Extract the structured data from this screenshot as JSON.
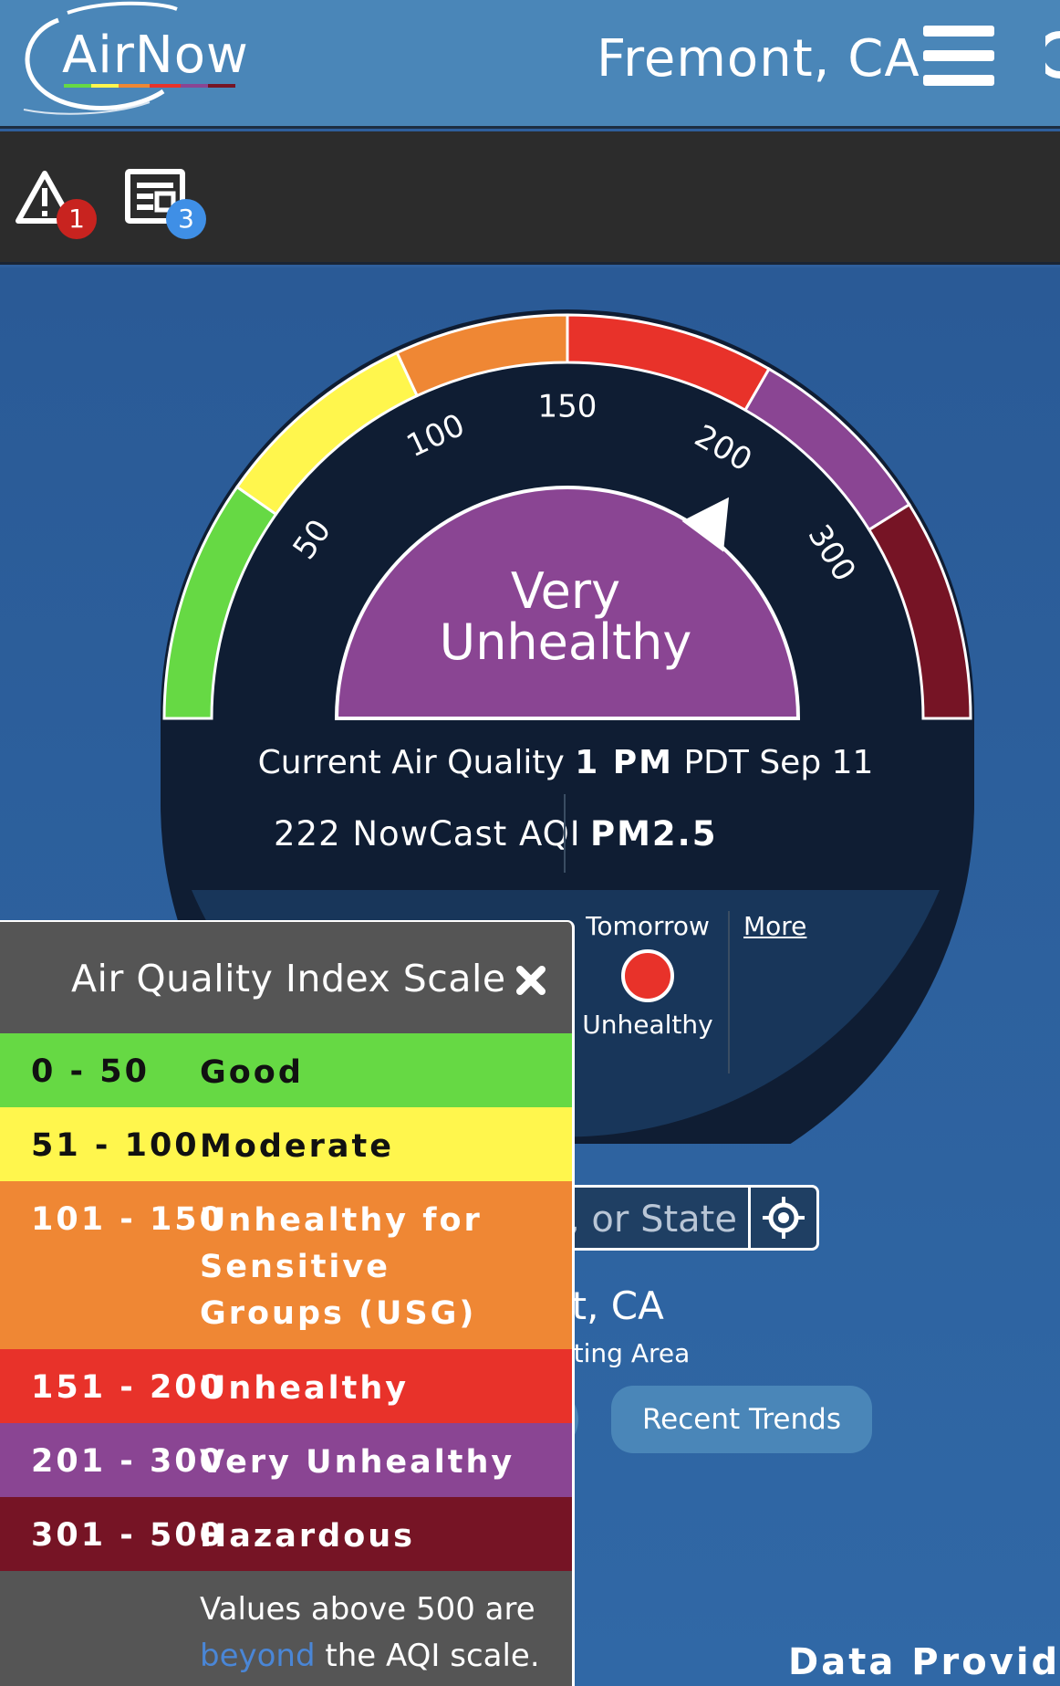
{
  "header": {
    "logo_text": "AirNow",
    "city": "Fremont, CA"
  },
  "toolbar": {
    "alerts_count": "1",
    "news_count": "3"
  },
  "gauge": {
    "tick_labels": [
      "50",
      "100",
      "150",
      "200",
      "300"
    ],
    "category": "Very Unhealthy",
    "category_line1": "Very",
    "category_line2": "Unhealthy",
    "aqi_value": 222,
    "current_prefix": "Current Air Quality",
    "current_time": "1 PM",
    "current_suffix": "PDT Sep 11",
    "aqi_text": "222 NowCast AQI",
    "pollutant": "PM2.5",
    "colors": {
      "good": "#66d944",
      "moderate": "#fff64d",
      "usg": "#ef8734",
      "unhealthy": "#e8322a",
      "very_unhealthy": "#8a4593",
      "hazardous": "#761425"
    }
  },
  "forecast": {
    "day_label": "Tomorrow",
    "category": "Unhealthy",
    "dot_color": "#e8322a",
    "more_label": "More"
  },
  "search": {
    "placeholder_visible": ", or State"
  },
  "location": {
    "city_partial": "nt, CA",
    "area_partial": "orting Area"
  },
  "buttons": {
    "recent_trends": "Recent Trends"
  },
  "footer": {
    "data_provider": "Data Provider"
  },
  "scale": {
    "title": "Air Quality Index Scale",
    "rows": [
      {
        "range": "0 - 50",
        "label": "Good",
        "color": "#66d944",
        "text_color": "#111"
      },
      {
        "range": "51 - 100",
        "label": "Moderate",
        "color": "#fff64d",
        "text_color": "#111"
      },
      {
        "range": "101 - 150",
        "label": "Unhealthy for Sensitive Groups (USG)",
        "color": "#ef8734",
        "text_color": "#fff"
      },
      {
        "range": "151 - 200",
        "label": "Unhealthy",
        "color": "#e8322a",
        "text_color": "#fff"
      },
      {
        "range": "201 - 300",
        "label": "Very Unhealthy",
        "color": "#8a4593",
        "text_color": "#fff"
      },
      {
        "range": "301 - 500",
        "label": "Hazardous",
        "color": "#761425",
        "text_color": "#fff"
      }
    ],
    "note_prefix": "Values above 500 are",
    "note_link": "beyond",
    "note_suffix": "the AQI scale."
  }
}
